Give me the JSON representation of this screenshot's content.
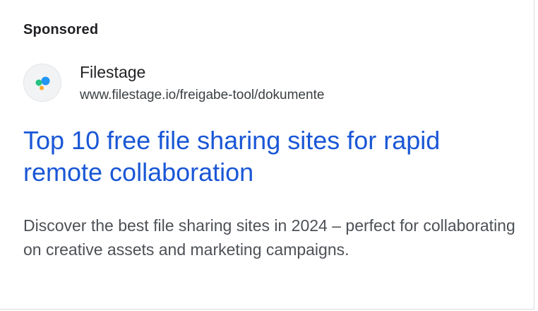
{
  "ad": {
    "sponsored_label": "Sponsored",
    "advertiser_name": "Filestage",
    "display_url": "www.filestage.io/freigabe-tool/dokumente",
    "headline": "Top 10 free file sharing sites for rapid remote collaboration",
    "description": "Discover the best file sharing sites in 2024 – perfect for collaborating on creative assets and marketing campaigns.",
    "favicon": {
      "icon": "filestage-logo-icon",
      "colors": [
        "#2196f3",
        "#26c281",
        "#ffa726"
      ]
    },
    "colors": {
      "headline": "#1a57d6",
      "text": "#202124",
      "description": "#4d5156"
    }
  }
}
